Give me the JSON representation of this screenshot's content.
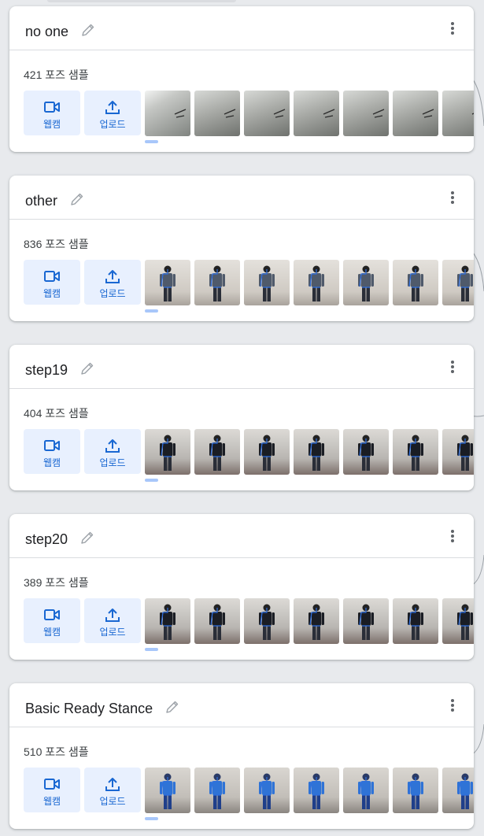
{
  "cards": [
    {
      "name": "no one",
      "count": "421 포즈 샘플",
      "webcam_label": "웹캠",
      "upload_label": "업로드",
      "thumb_style": "wall"
    },
    {
      "name": "other",
      "count": "836 포즈 샘플",
      "webcam_label": "웹캠",
      "upload_label": "업로드",
      "thumb_style": "pose-light"
    },
    {
      "name": "step19",
      "count": "404 포즈 샘플",
      "webcam_label": "웹캠",
      "upload_label": "업로드",
      "thumb_style": "pose-dark"
    },
    {
      "name": "step20",
      "count": "389 포즈 샘플",
      "webcam_label": "웹캠",
      "upload_label": "업로드",
      "thumb_style": "pose-dark"
    },
    {
      "name": "Basic Ready Stance",
      "count": "510 포즈 샘플",
      "webcam_label": "웹캠",
      "upload_label": "업로드",
      "thumb_style": "pose-blue"
    }
  ],
  "colors": {
    "accent": "#1967d2",
    "button_bg": "#e8f0fe",
    "page_bg": "#e8eaed",
    "skeleton": "#2f6fe0"
  },
  "icons": {
    "edit": "pencil-icon",
    "more": "more-vert-icon",
    "webcam": "videocam-icon",
    "upload": "upload-icon"
  }
}
